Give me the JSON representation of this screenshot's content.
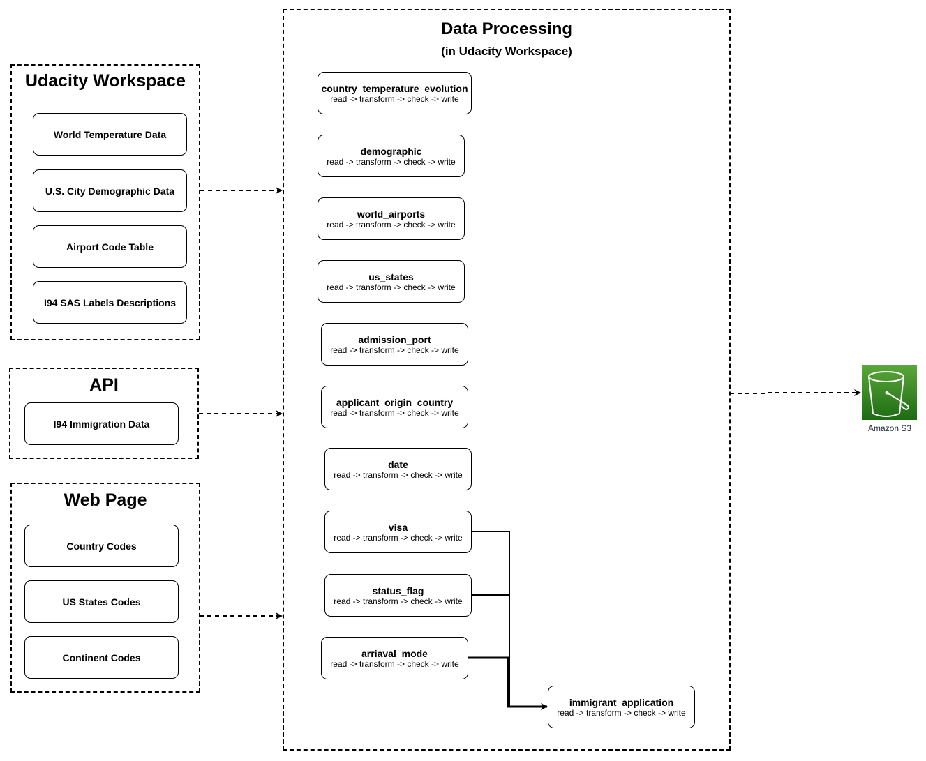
{
  "groups": {
    "udacity_workspace": {
      "title": "Udacity Workspace",
      "items": [
        "World Temperature Data",
        "U.S. City Demographic Data",
        "Airport Code Table",
        "I94 SAS Labels Descriptions"
      ]
    },
    "api": {
      "title": "API",
      "items": [
        "I94 Immigration Data"
      ]
    },
    "web_page": {
      "title": "Web Page",
      "items": [
        "Country Codes",
        "US States Codes",
        "Continent Codes"
      ]
    },
    "data_processing": {
      "title": "Data Processing",
      "subtitle": "(in Udacity Workspace)",
      "steps_label": "read -> transform -> check -> write",
      "jobs": [
        "country_temperature_evolution",
        "demographic",
        "world_airports",
        "us_states",
        "admission_port",
        "applicant_origin_country",
        "date",
        "visa",
        "status_flag",
        "arriaval_mode",
        "immigrant_application"
      ]
    }
  },
  "destination": {
    "icon": "amazon-s3-bucket-icon",
    "label": "Amazon S3",
    "color": "#3f8624"
  }
}
